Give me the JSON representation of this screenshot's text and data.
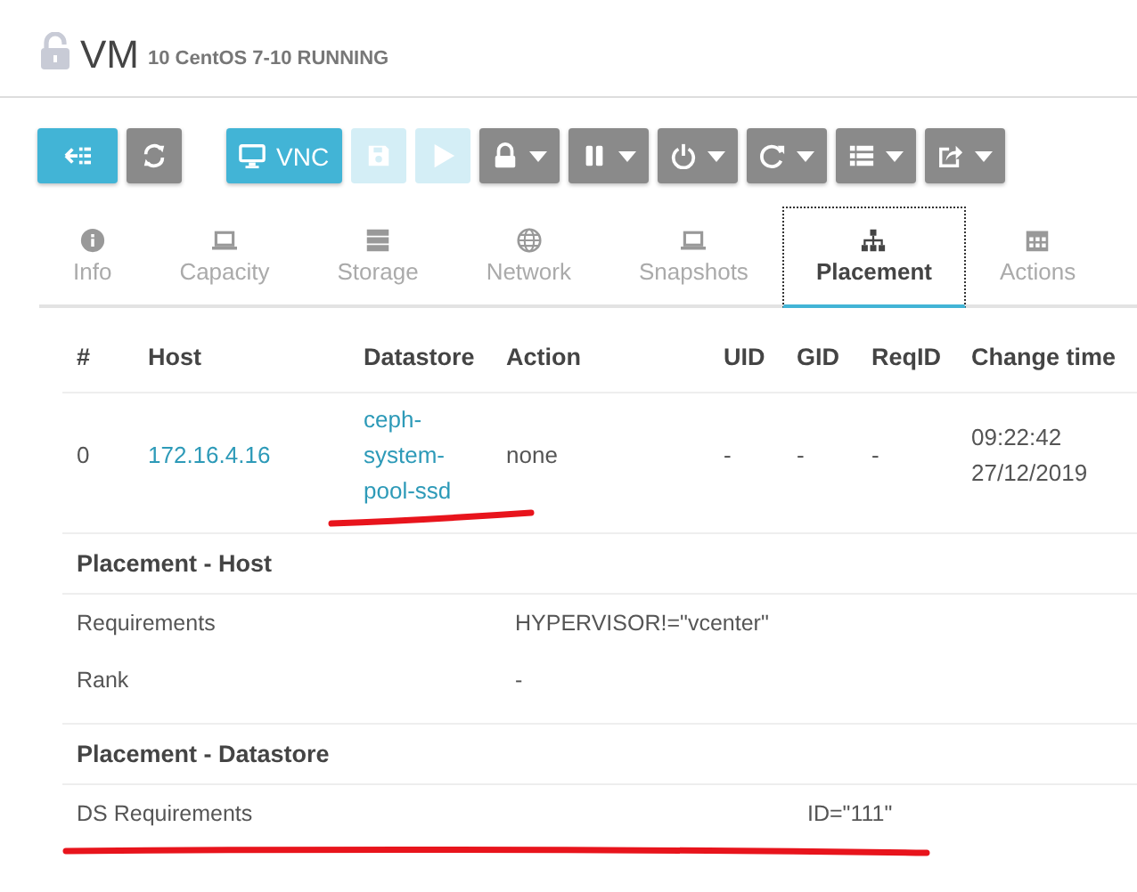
{
  "header": {
    "title": "VM",
    "subtitle": "10 CentOS 7-10 RUNNING"
  },
  "toolbar": [
    [
      {
        "disabled": false,
        "caret": false
      },
      {
        "disabled": false,
        "caret": false
      }
    ],
    [
      {
        "label": "VNC",
        "disabled": false,
        "caret": false
      },
      {
        "disabled": true,
        "caret": false
      },
      {
        "disabled": true,
        "caret": false
      },
      {
        "disabled": false,
        "caret": true
      },
      {
        "disabled": false,
        "caret": true
      },
      {
        "disabled": false,
        "caret": true
      },
      {
        "disabled": false,
        "caret": true
      },
      {
        "disabled": false,
        "caret": true
      },
      {
        "disabled": false,
        "caret": true
      }
    ]
  ],
  "tabs": [
    {
      "label": "Info",
      "selected": false
    },
    {
      "label": "Capacity",
      "selected": false
    },
    {
      "label": "Storage",
      "selected": false
    },
    {
      "label": "Network",
      "selected": false
    },
    {
      "label": "Snapshots",
      "selected": false
    },
    {
      "label": "Placement",
      "selected": true
    },
    {
      "label": "Actions",
      "selected": false
    }
  ],
  "table": {
    "columns": [
      "#",
      "Host",
      "Datastore",
      "Action",
      "UID",
      "GID",
      "ReqID",
      "Change time"
    ],
    "rows": [
      {
        "cells": [
          {
            "text": "0",
            "link": false
          },
          {
            "text": "172.16.4.16",
            "link": true
          },
          {
            "text": "ceph-system-pool-ssd",
            "link": true
          },
          {
            "text": "none",
            "link": false
          },
          {
            "text": "-",
            "link": false
          },
          {
            "text": "-",
            "link": false
          },
          {
            "text": "-",
            "link": false
          },
          {
            "text": "09:22:42 27/12/2019",
            "link": false
          }
        ]
      }
    ]
  },
  "sections": [
    {
      "title": "Placement - Host",
      "rows": [
        {
          "label": "Requirements",
          "value": "HYPERVISOR!=\"vcenter\""
        },
        {
          "label": "Rank",
          "value": "-"
        }
      ]
    },
    {
      "title": "Placement - Datastore",
      "rows": [
        {
          "label": "DS Requirements",
          "value": "ID=\"111\""
        }
      ]
    }
  ]
}
